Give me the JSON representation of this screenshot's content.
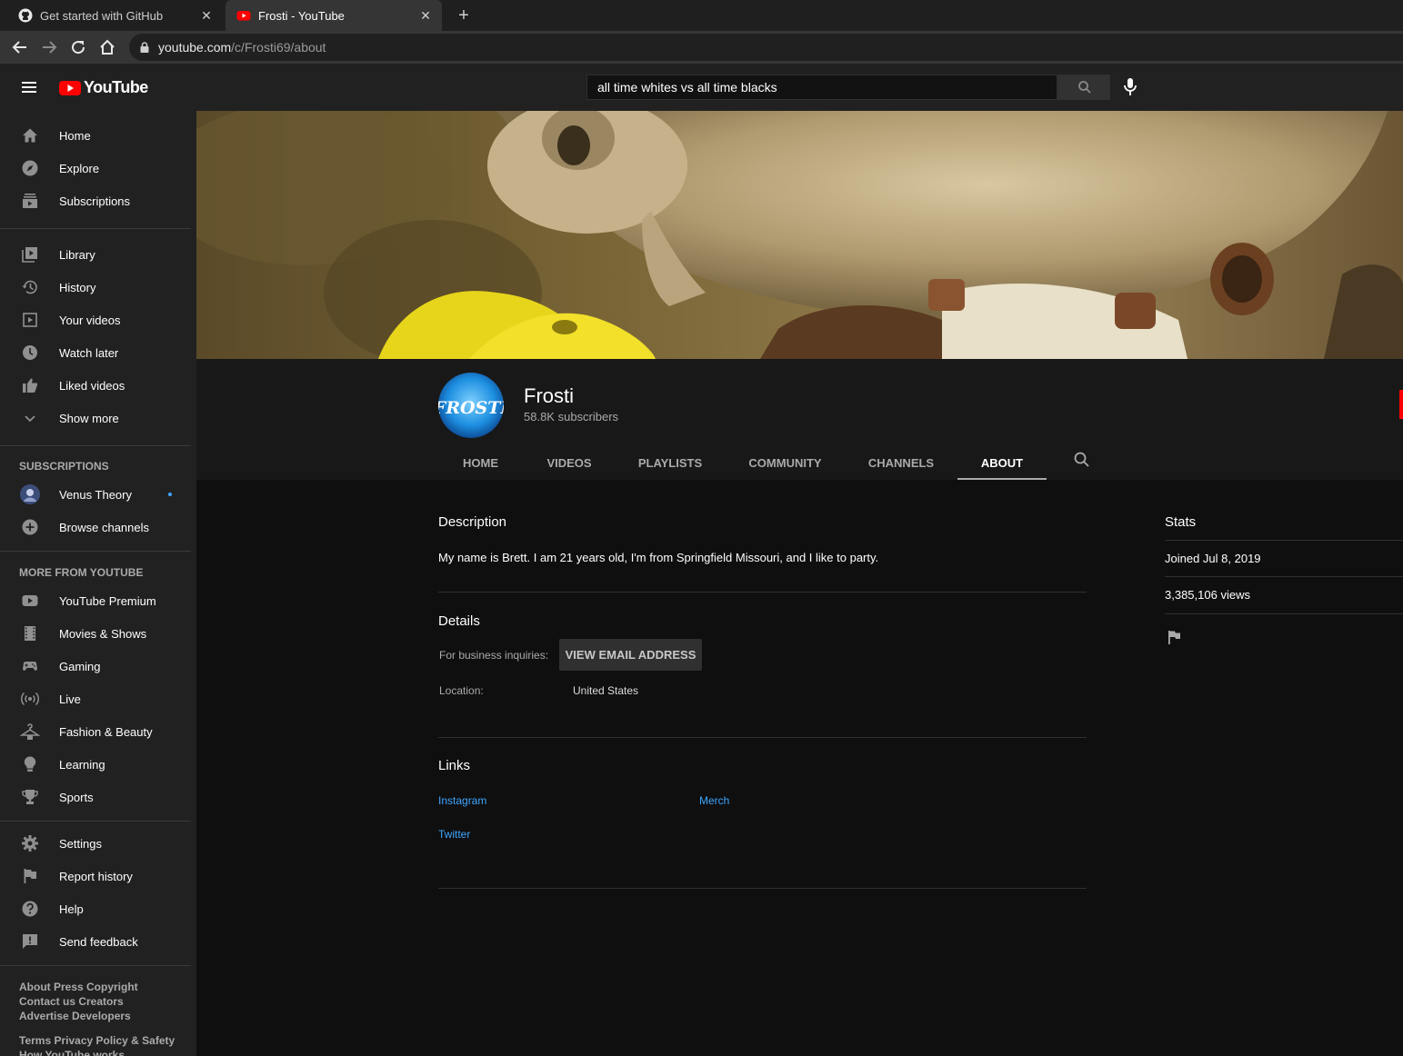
{
  "browser": {
    "tabs": [
      {
        "title": "Get started with GitHub",
        "icon": "github-icon",
        "active": false
      },
      {
        "title": "Frosti - YouTube",
        "icon": "youtube-favicon",
        "active": true
      }
    ],
    "new_tab_icon": "plus-icon",
    "url_host": "youtube.com",
    "url_path": "/c/Frosti69/about"
  },
  "masthead": {
    "logo_text": "YouTube",
    "search_value": "all time whites vs all time blacks"
  },
  "sidebar": {
    "main": [
      {
        "label": "Home",
        "icon": "home-icon"
      },
      {
        "label": "Explore",
        "icon": "compass-icon"
      },
      {
        "label": "Subscriptions",
        "icon": "subscriptions-icon"
      }
    ],
    "library": [
      {
        "label": "Library",
        "icon": "library-icon"
      },
      {
        "label": "History",
        "icon": "history-icon"
      },
      {
        "label": "Your videos",
        "icon": "your-videos-icon"
      },
      {
        "label": "Watch later",
        "icon": "clock-icon"
      },
      {
        "label": "Liked videos",
        "icon": "thumbs-up-icon"
      },
      {
        "label": "Show more",
        "icon": "chevron-down-icon"
      }
    ],
    "subscriptions_heading": "SUBSCRIPTIONS",
    "subscriptions": [
      {
        "label": "Venus Theory",
        "icon": "channel-avatar"
      },
      {
        "label": "Browse channels",
        "icon": "add-circle-icon"
      }
    ],
    "more_heading": "MORE FROM YOUTUBE",
    "more": [
      {
        "label": "YouTube Premium",
        "icon": "youtube-premium-icon"
      },
      {
        "label": "Movies & Shows",
        "icon": "film-icon"
      },
      {
        "label": "Gaming",
        "icon": "gamepad-icon"
      },
      {
        "label": "Live",
        "icon": "live-icon"
      },
      {
        "label": "Fashion & Beauty",
        "icon": "hanger-icon"
      },
      {
        "label": "Learning",
        "icon": "lightbulb-icon"
      },
      {
        "label": "Sports",
        "icon": "trophy-icon"
      }
    ],
    "settings": [
      {
        "label": "Settings",
        "icon": "gear-icon"
      },
      {
        "label": "Report history",
        "icon": "flag-icon"
      },
      {
        "label": "Help",
        "icon": "help-icon"
      },
      {
        "label": "Send feedback",
        "icon": "feedback-icon"
      }
    ],
    "footer": {
      "line1": "About  Press  Copyright",
      "line2": "Contact us  Creators",
      "line3": "Advertise  Developers",
      "line4": "Terms  Privacy  Policy & Safety",
      "line5": "How YouTube works"
    }
  },
  "channel": {
    "name": "Frosti",
    "subscribers": "58.8K subscribers",
    "avatar_text": "FROSTI",
    "tabs": [
      "HOME",
      "VIDEOS",
      "PLAYLISTS",
      "COMMUNITY",
      "CHANNELS",
      "ABOUT"
    ],
    "active_tab": "ABOUT"
  },
  "about": {
    "description_heading": "Description",
    "description": "My name is Brett. I am 21 years old, I'm from Springfield Missouri, and I like to party.",
    "details_heading": "Details",
    "business_label": "For business inquiries:",
    "email_button": "VIEW EMAIL ADDRESS",
    "location_label": "Location:",
    "location_value": "United States",
    "links_heading": "Links",
    "links": [
      "Instagram",
      "Merch",
      "Twitter"
    ],
    "stats_heading": "Stats",
    "joined": "Joined Jul 8, 2019",
    "views": "3,385,106 views"
  },
  "colors": {
    "bg": "#0f0f0f",
    "masthead": "#212121",
    "accent_red": "#ff0000",
    "link_blue": "#3ea6ff"
  }
}
